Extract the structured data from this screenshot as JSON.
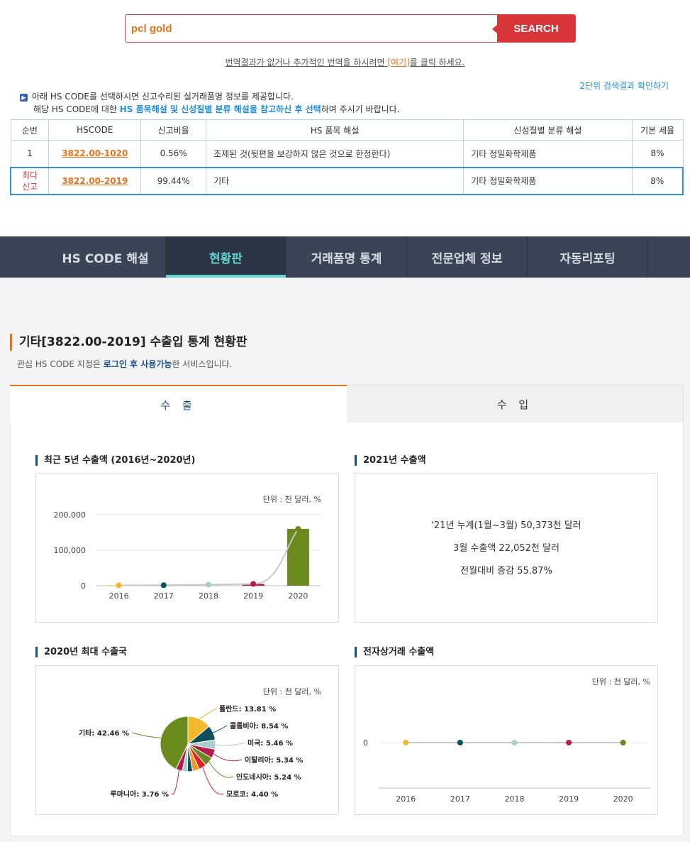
{
  "search": {
    "value": "pcl gold",
    "button_label": "SEARCH"
  },
  "translate_note": {
    "prefix": "번역결과가 없거나 추가적인 번역을 하시려면 ",
    "link": "[여기]",
    "suffix": "를 클릭 하세요."
  },
  "level2_link": "2단위 검색결과 확인하기",
  "info": {
    "line1": "아래 HS CODE를 선택하시면 신고수리된 실거래품명 정보를 제공합니다.",
    "line2_a": "해당 HS CODE에 대한 ",
    "line2_hl": "HS 품목해설 및 신성질별 분류 해설을 참고하신 후 선택",
    "line2_b": "하여 주시기 바랍니다."
  },
  "hs_table": {
    "headers": [
      "순번",
      "HSCODE",
      "신고비율",
      "HS 품목 해설",
      "신성질별 분류 해설",
      "기본 세율"
    ],
    "rows": [
      {
        "rank": "1",
        "code": "3822.00-1020",
        "ratio": "0.56%",
        "desc": "조제된 것(뒷편을 보강하지 않은 것으로 한정한다)",
        "class": "기타 정밀화학제품",
        "rate": "8%"
      },
      {
        "rank_line1": "최다",
        "rank_line2": "신고",
        "code": "3822.00-2019",
        "ratio": "99.44%",
        "desc": "기타",
        "class": "기타 정밀화학제품",
        "rate": "8%"
      }
    ]
  },
  "nav": {
    "tabs": [
      "HS CODE 해설",
      "현황판",
      "거래품명 통계",
      "전문업체 정보",
      "자동리포팅"
    ],
    "active": "현황판"
  },
  "dashboard": {
    "title": "기타[3822.00-2019] 수출입 통계 현황판",
    "sub_a": "관심 HS CODE 지정은 ",
    "sub_b": "로그인 후 사용가능",
    "sub_c": "한 서비스입니다.",
    "tab_export": "수 출",
    "tab_import": "수 입"
  },
  "box1": {
    "title": "최근 5년 수출액 (2016년~2020년)",
    "unit": "단위 : 천 달러, %"
  },
  "box2": {
    "title": "2021년 수출액",
    "line1": "'21년 누계(1월~3월) 50,373천 달러",
    "line2": "3월 수출액 22,052천 달러",
    "line3": "전월대비 증감 55.87%"
  },
  "box3": {
    "title": "2020년 최대 수출국",
    "unit": "단위 : 천 달러, %"
  },
  "box4": {
    "title": "전자상거래 수출액",
    "unit": "단위 : 천 달러, %"
  },
  "colors": {
    "y2016": "#f2b92d",
    "y2017": "#0b4f5f",
    "y2018": "#a9cfcd",
    "y2019": "#b51c4d",
    "y2020": "#6b8a1e"
  },
  "chart_data": [
    {
      "type": "bar",
      "categories": [
        "2016",
        "2017",
        "2018",
        "2019",
        "2020"
      ],
      "values": [
        1000,
        1500,
        3000,
        5000,
        160000
      ],
      "ylim": [
        0,
        200000
      ],
      "yticks": [
        "0",
        "100,000",
        "200,000"
      ]
    },
    {
      "type": "pie",
      "slices": [
        {
          "label": "폴란드",
          "value": 13.81,
          "color": "#f2b92d",
          "text": "폴란드: 13.81 %"
        },
        {
          "label": "콜롬비아",
          "value": 8.54,
          "color": "#0b4f5f",
          "text": "콜롬비아: 8.54 %"
        },
        {
          "label": "미국",
          "value": 5.46,
          "color": "#a9cfcd",
          "text": "미국: 5.46 %"
        },
        {
          "label": "이탈리아",
          "value": 5.34,
          "color": "#b51c4d",
          "text": "이탈리아: 5.34 %"
        },
        {
          "label": "인도네시아",
          "value": 5.24,
          "color": "#6b8a1e",
          "text": "인도네시아: 5.24 %"
        },
        {
          "label": "모로코",
          "value": 4.4,
          "color": "#e02323",
          "text": "모로코: 4.40 %"
        },
        {
          "label": "",
          "value": 4.0,
          "color": "#f59a22",
          "text": ""
        },
        {
          "label": "",
          "value": 3.0,
          "color": "#0b4f5f",
          "text": ""
        },
        {
          "label": "",
          "value": 3.0,
          "color": "#a9cfcd",
          "text": ""
        },
        {
          "label": "루마니아",
          "value": 3.76,
          "color": "#b51c4d",
          "text": "루마니아: 3.76 %"
        },
        {
          "label": "기타",
          "value": 42.46,
          "color": "#6b8a1e",
          "text": "기타: 42.46 %"
        }
      ]
    },
    {
      "type": "line",
      "categories": [
        "2016",
        "2017",
        "2018",
        "2019",
        "2020"
      ],
      "values": [
        0,
        0,
        0,
        0,
        0
      ],
      "yticks": [
        "0"
      ]
    }
  ]
}
